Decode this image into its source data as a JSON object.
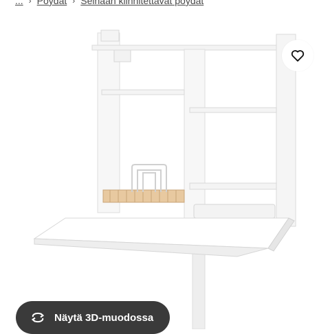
{
  "breadcrumb": {
    "items": [
      {
        "label": "..."
      },
      {
        "label": "Pöydät"
      },
      {
        "label": "Seinään kiinnitettävät pöydät"
      }
    ]
  },
  "product_image": {
    "description_icon": "wall-mounted-desk-photo"
  },
  "favourite_button": {
    "icon": "heart-outline-icon"
  },
  "view_3d_button": {
    "label": "Näytä 3D-muodossa",
    "icon": "rotate-3d-icon",
    "background": "#3a3a3a"
  },
  "colors": {
    "accent_dark": "#3a3a3a",
    "text": "#484848",
    "background": "#ffffff"
  }
}
